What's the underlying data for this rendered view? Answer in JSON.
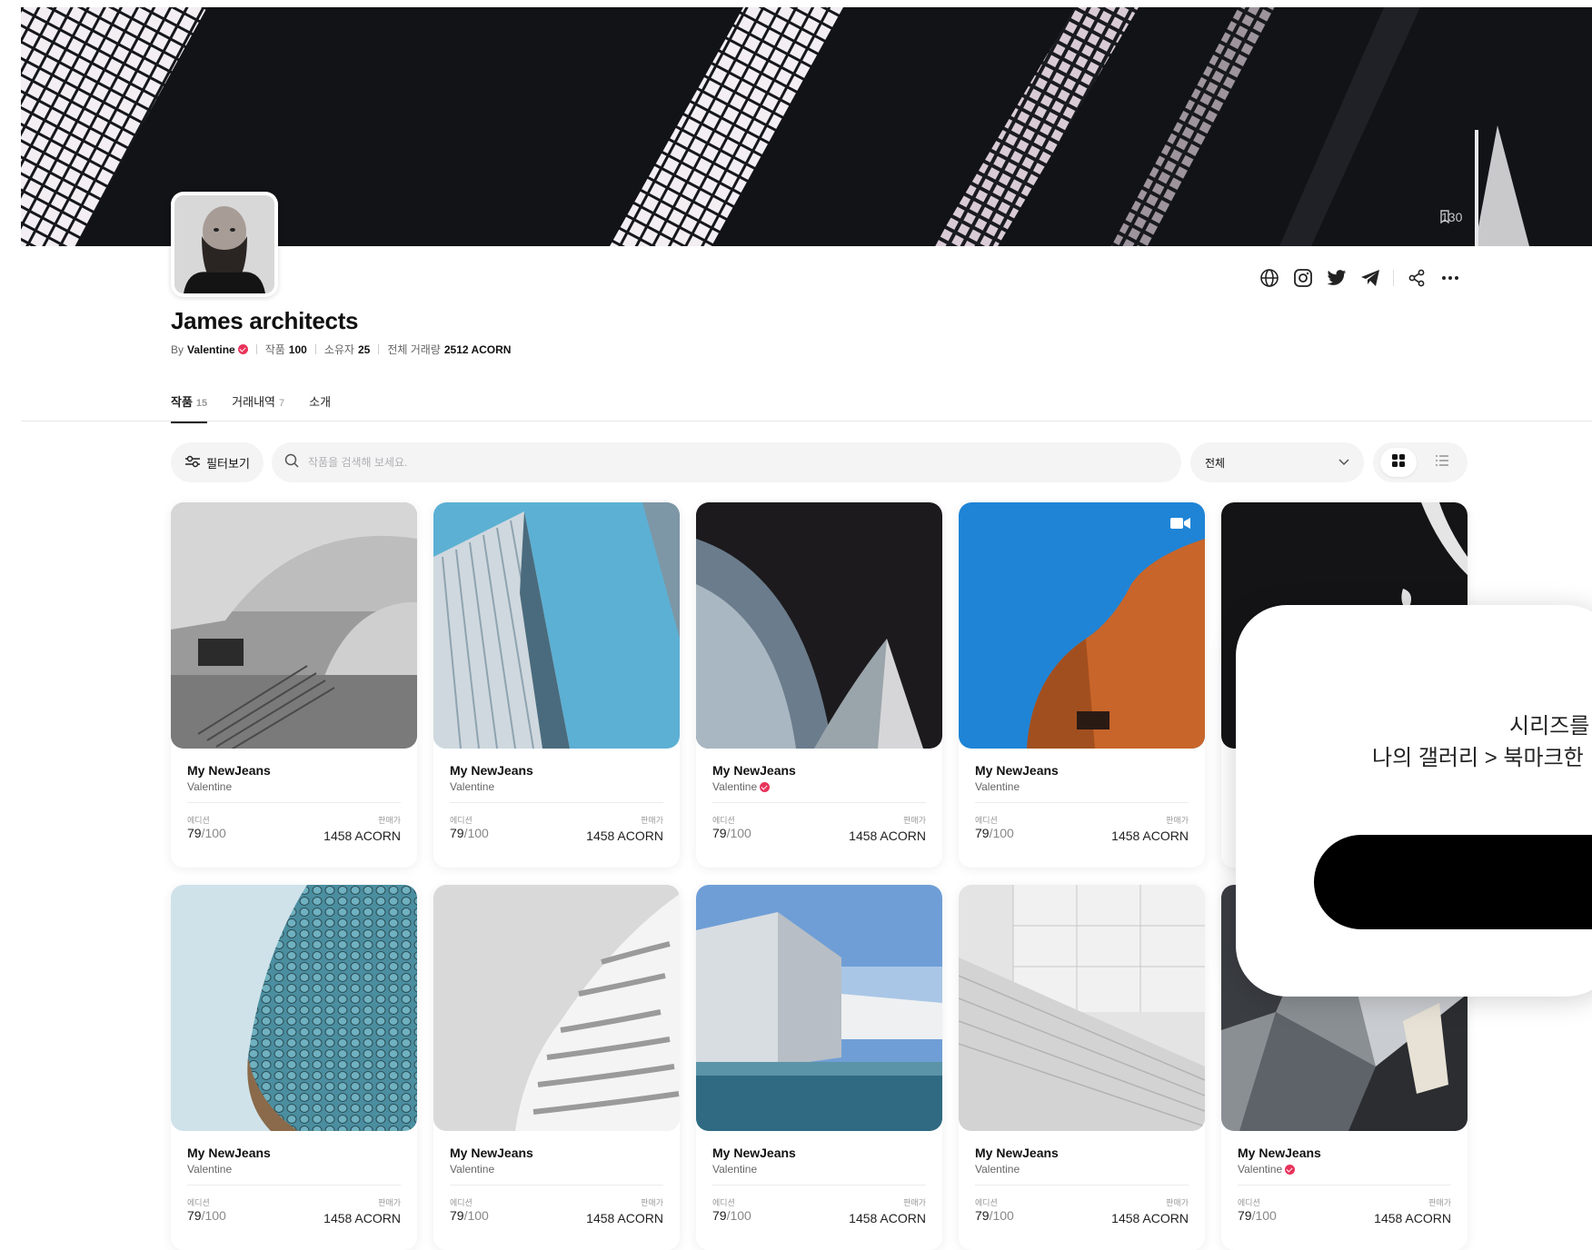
{
  "banner": {
    "bookmark_count": "130"
  },
  "profile": {
    "name": "James architects",
    "by_label": "By",
    "creator": "Valentine",
    "works_label": "작품",
    "works_count": "100",
    "owners_label": "소유자",
    "owners_count": "25",
    "volume_label": "전체 거래량",
    "volume_value": "2512 ACORN"
  },
  "social_icons": [
    "globe-icon",
    "instagram-icon",
    "twitter-icon",
    "telegram-icon",
    "share-icon",
    "more-icon"
  ],
  "tabs": [
    {
      "label": "작품",
      "count": "15"
    },
    {
      "label": "거래내역",
      "count": "7"
    },
    {
      "label": "소개",
      "count": ""
    }
  ],
  "toolbar": {
    "filter_label": "필터보기",
    "search_placeholder": "작품을 검색해 보세요.",
    "select_value": "전체"
  },
  "card_labels": {
    "edition": "에디션",
    "price": "판매가"
  },
  "cards": [
    {
      "title": "My NewJeans",
      "artist": "Valentine",
      "verified": false,
      "edition": "79",
      "total": "/100",
      "price": "1458 ACORN"
    },
    {
      "title": "My NewJeans",
      "artist": "Valentine",
      "verified": false,
      "edition": "79",
      "total": "/100",
      "price": "1458 ACORN"
    },
    {
      "title": "My NewJeans",
      "artist": "Valentine",
      "verified": true,
      "edition": "79",
      "total": "/100",
      "price": "1458 ACORN"
    },
    {
      "title": "My NewJeans",
      "artist": "Valentine",
      "verified": false,
      "edition": "79",
      "total": "/100",
      "price": "1458 ACORN"
    },
    {
      "title": "",
      "artist": "",
      "verified": false,
      "edition": "",
      "total": "",
      "price": ""
    },
    {
      "title": "My NewJeans",
      "artist": "Valentine",
      "verified": false,
      "edition": "79",
      "total": "/100",
      "price": "1458 ACORN"
    },
    {
      "title": "My NewJeans",
      "artist": "Valentine",
      "verified": false,
      "edition": "79",
      "total": "/100",
      "price": "1458 ACORN"
    },
    {
      "title": "My NewJeans",
      "artist": "Valentine",
      "verified": false,
      "edition": "79",
      "total": "/100",
      "price": "1458 ACORN"
    },
    {
      "title": "My NewJeans",
      "artist": "Valentine",
      "verified": false,
      "edition": "79",
      "total": "/100",
      "price": "1458 ACORN"
    },
    {
      "title": "My NewJeans",
      "artist": "Valentine",
      "verified": true,
      "edition": "79",
      "total": "/100",
      "price": "1458 ACORN"
    }
  ],
  "modal": {
    "line1": "시리즈를",
    "line2": "나의 갤러리 > 북마크한"
  },
  "colors": {
    "accent_verified": "#e8335b",
    "banner_bg": "#121317",
    "modal_button": "#000000"
  }
}
